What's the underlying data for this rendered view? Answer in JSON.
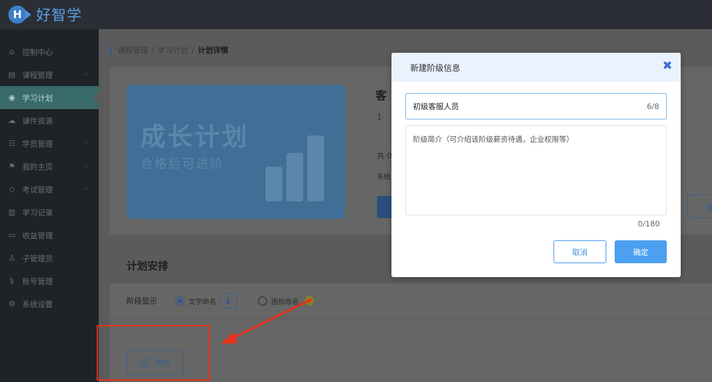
{
  "app": {
    "logo_letter": "H",
    "logo_text": "好智学"
  },
  "sidebar": {
    "items": [
      {
        "label": "控制中心",
        "icon": "home-icon",
        "glyph": "⌂",
        "chevron": ""
      },
      {
        "label": "课程管理",
        "icon": "book-icon",
        "glyph": "▤",
        "chevron": "‹"
      },
      {
        "label": "学习计划",
        "icon": "eye-icon",
        "glyph": "◉",
        "chevron": "",
        "active": true
      },
      {
        "label": "课件资源",
        "icon": "cloud-icon",
        "glyph": "☁",
        "chevron": ""
      },
      {
        "label": "学员管理",
        "icon": "users-icon",
        "glyph": "☷",
        "chevron": "‹"
      },
      {
        "label": "我的主页",
        "icon": "flag-icon",
        "glyph": "⚑",
        "chevron": "‹"
      },
      {
        "label": "考试管理",
        "icon": "tag-icon",
        "glyph": "◇",
        "chevron": "‹"
      },
      {
        "label": "学习记录",
        "icon": "notebook-icon",
        "glyph": "▥",
        "chevron": ""
      },
      {
        "label": "收益管理",
        "icon": "card-icon",
        "glyph": "▭",
        "chevron": ""
      },
      {
        "label": "子管理员",
        "icon": "user-icon",
        "glyph": "♙",
        "chevron": ""
      },
      {
        "label": "账号管理",
        "icon": "dollar-icon",
        "glyph": "$",
        "chevron": ""
      },
      {
        "label": "系统设置",
        "icon": "gear-icon",
        "glyph": "⚙",
        "chevron": ""
      }
    ]
  },
  "breadcrumb": {
    "item1": "课程管理",
    "sep": "/",
    "item2": "学习计划",
    "current": "计划详情"
  },
  "plan_card": {
    "banner_title": "成长计划",
    "banner_subtitle": "合格后可进阶",
    "title_partial": "客",
    "line1": "1",
    "line2": "共 0",
    "line3": "系统",
    "right_button_partial": "通"
  },
  "schedule": {
    "section_title": "计划安排",
    "stage_display_label": "阶段显示",
    "option_text": "文字命名",
    "option_text_letter": "L",
    "option_icon": "图标命名",
    "add_button": "添加"
  },
  "modal": {
    "title": "新建阶级信息",
    "close_glyph": "✖",
    "name_value": "初级客服人员",
    "name_count": "6/8",
    "desc_placeholder": "阶级简介（可介绍该阶级薪资待遇，企业权限等）",
    "desc_count": "0/180",
    "cancel_label": "取消",
    "ok_label": "确定"
  },
  "colors": {
    "accent": "#4da0f0",
    "annotation": "#e8301c",
    "sidebar_active": "#3a6b6b"
  }
}
